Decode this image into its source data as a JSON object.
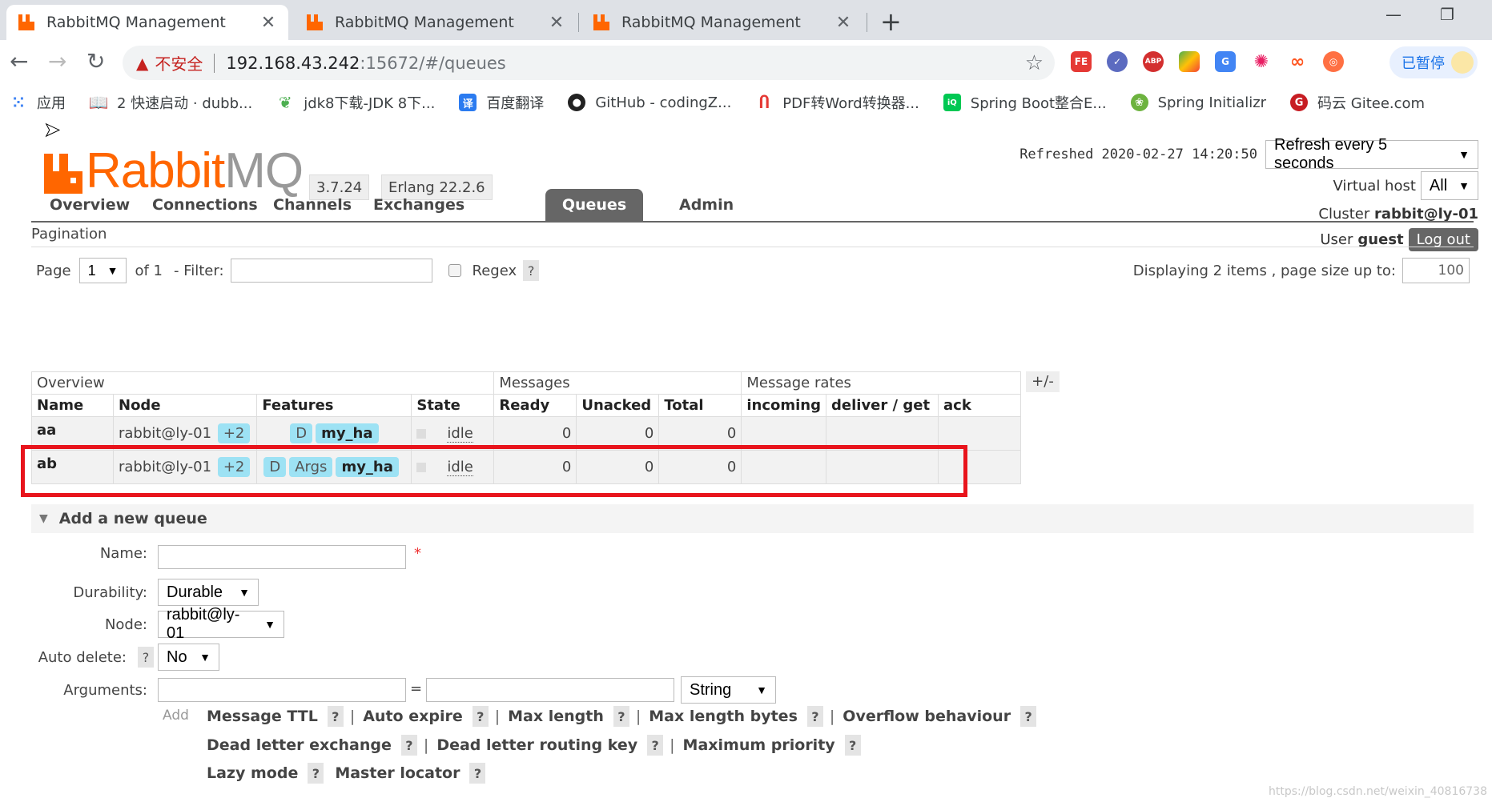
{
  "browser": {
    "tabs": [
      {
        "title": "RabbitMQ Management",
        "active": true
      },
      {
        "title": "RabbitMQ Management",
        "active": false
      },
      {
        "title": "RabbitMQ Management",
        "active": false
      }
    ],
    "url": {
      "warning_label": "不安全",
      "host": "192.168.43.242",
      "path": ":15672/#/queues"
    },
    "profile_label": "已暂停",
    "bookmarks": [
      {
        "label": "应用",
        "icon": "apps-grid-icon"
      },
      {
        "label": "2 快速启动 · dubb...",
        "icon": "book-icon"
      },
      {
        "label": "jdk8下载-JDK 8下...",
        "icon": "leaf-icon"
      },
      {
        "label": "百度翻译",
        "icon": "translate-icon"
      },
      {
        "label": "GitHub - codingZ...",
        "icon": "github-icon"
      },
      {
        "label": "PDF转Word转换器...",
        "icon": "pdf-icon"
      },
      {
        "label": "Spring Boot整合E...",
        "icon": "iqiyi-icon"
      },
      {
        "label": "Spring Initializr",
        "icon": "spring-icon"
      },
      {
        "label": "码云 Gitee.com",
        "icon": "gitee-icon"
      }
    ]
  },
  "app": {
    "logo_text_rabbit": "Rabbit",
    "logo_text_mq": "MQ",
    "version": "3.7.24",
    "erlang": "Erlang 22.2.6",
    "refreshed": "Refreshed 2020-02-27 14:20:50",
    "refresh_option": "Refresh every 5 seconds",
    "virtual_host_label": "Virtual host",
    "virtual_host_value": "All",
    "cluster_label": "Cluster",
    "cluster_value": "rabbit@ly-01",
    "user_label": "User",
    "user_value": "guest",
    "logout_label": "Log out",
    "nav": [
      "Overview",
      "Connections",
      "Channels",
      "Exchanges",
      "Queues",
      "Admin"
    ],
    "active_nav": "Queues"
  },
  "pagination": {
    "section_label": "Pagination",
    "page_label": "Page",
    "page_value": "1",
    "of_label": "of 1",
    "filter_label": "- Filter:",
    "regex_label": "Regex",
    "help": "?",
    "displaying": "Displaying 2 items , page size up to:",
    "page_size": "100"
  },
  "table": {
    "groups": {
      "overview": "Overview",
      "messages": "Messages",
      "rates": "Message rates"
    },
    "columns": [
      "Name",
      "Node",
      "Features",
      "State",
      "Ready",
      "Unacked",
      "Total",
      "incoming",
      "deliver / get",
      "ack"
    ],
    "toggle": "+/-",
    "rows": [
      {
        "name": "aa",
        "node": "rabbit@ly-01",
        "node_extra": "+2",
        "features": [
          "D",
          "my_ha"
        ],
        "state": "idle",
        "ready": "0",
        "unacked": "0",
        "total": "0"
      },
      {
        "name": "ab",
        "node": "rabbit@ly-01",
        "node_extra": "+2",
        "features": [
          "D",
          "Args",
          "my_ha"
        ],
        "state": "idle",
        "ready": "0",
        "unacked": "0",
        "total": "0"
      }
    ]
  },
  "add_queue": {
    "title": "Add a new queue",
    "name_label": "Name:",
    "required_mark": "*",
    "durability_label": "Durability:",
    "durability_value": "Durable",
    "node_label": "Node:",
    "node_value": "rabbit@ly-01",
    "auto_delete_label": "Auto delete:",
    "auto_delete_value": "No",
    "arguments_label": "Arguments:",
    "equals": "=",
    "arg_type": "String",
    "add_label": "Add",
    "arg_links_row1": [
      "Message TTL",
      "Auto expire",
      "Max length",
      "Max length bytes",
      "Overflow behaviour"
    ],
    "arg_links_row2": [
      "Dead letter exchange",
      "Dead letter routing key",
      "Maximum priority"
    ],
    "arg_links_row3": [
      "Lazy mode",
      "Master locator"
    ]
  },
  "watermark": "https://blog.csdn.net/weixin_40816738",
  "colors": {
    "brand": "#ff6600",
    "highlight": "#e8141c",
    "pill": "#9de2f4"
  }
}
